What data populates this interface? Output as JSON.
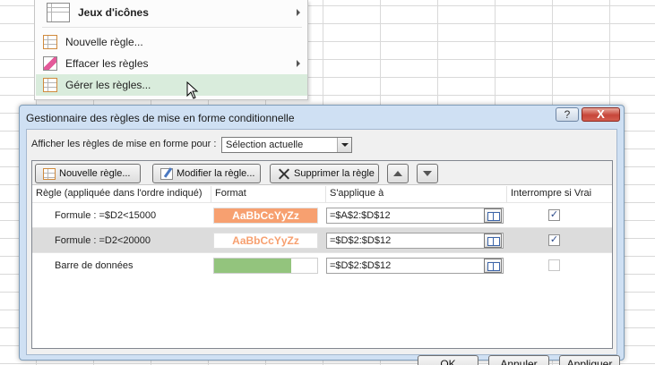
{
  "menu": {
    "items": [
      {
        "label": "Jeux d'icônes",
        "icon": "icon-sets-icon",
        "submenu": true
      },
      {
        "label": "Nouvelle règle...",
        "icon": "new-rule-icon",
        "submenu": false
      },
      {
        "label": "Effacer les règles",
        "icon": "clear-rules-icon",
        "submenu": true
      },
      {
        "label": "Gérer les règles...",
        "icon": "manage-rules-icon",
        "submenu": false,
        "hovered": true
      }
    ]
  },
  "dialog": {
    "title": "Gestionnaire des règles de mise en forme conditionnelle",
    "help": "?",
    "close": "X",
    "show_label": "Afficher les règles de mise en forme pour :",
    "show_value": "Sélection actuelle",
    "toolbar": {
      "new_rule": "Nouvelle règle...",
      "edit_rule": "Modifier la règle...",
      "delete_rule": "Supprimer la règle"
    },
    "columns": {
      "rule": "Règle (appliquée dans l'ordre indiqué)",
      "format": "Format",
      "applies": "S'applique à",
      "stop": "Interrompre si Vrai"
    },
    "rows": [
      {
        "rule": "Formule : =$D2<15000",
        "format_text": "AaBbCcYyZz",
        "format_style": "fill",
        "applies": "=$A$2:$D$12",
        "stop": true,
        "selected": false
      },
      {
        "rule": "Formule : =D2<20000",
        "format_text": "AaBbCcYyZz",
        "format_style": "text",
        "applies": "=$D$2:$D$12",
        "stop": true,
        "selected": true
      },
      {
        "rule": "Barre de données",
        "format_text": "",
        "format_style": "bar",
        "bar_level": 0.75,
        "applies": "=$D$2:$D$12",
        "stop": false,
        "selected": false
      }
    ],
    "buttons": {
      "ok": "OK",
      "cancel": "Annuler",
      "apply": "Appliquer"
    },
    "colors": {
      "format_fill": "#f7a070",
      "data_bar": "#93c47d",
      "menu_hover": "#d9ecdc"
    }
  }
}
